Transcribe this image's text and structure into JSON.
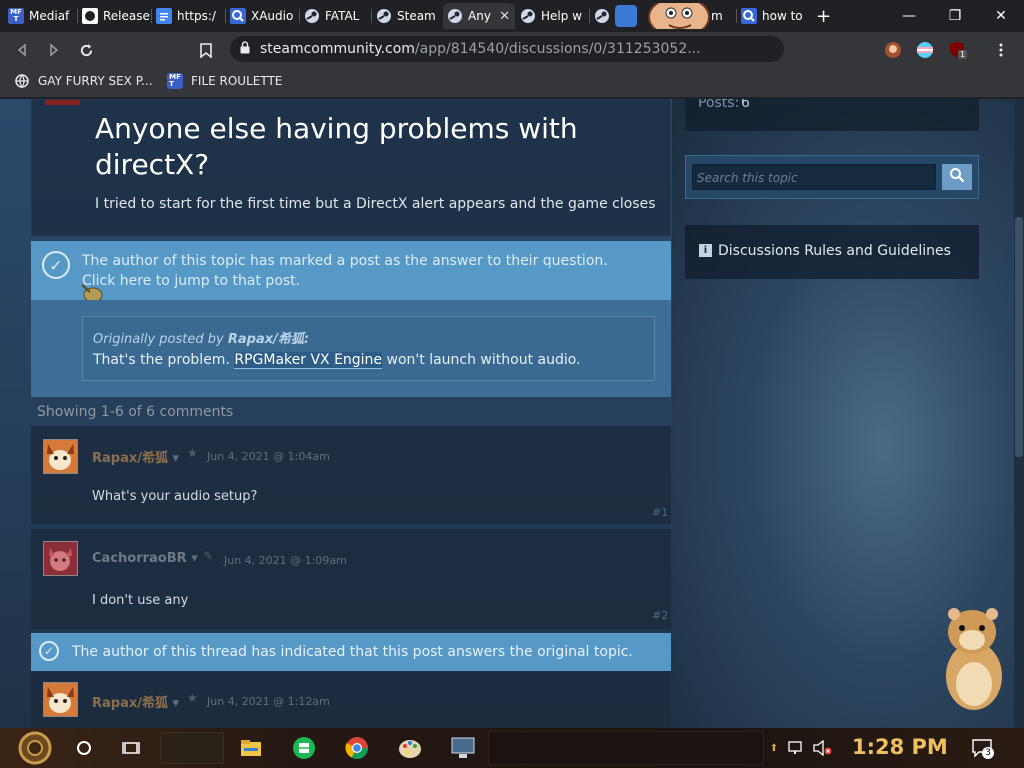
{
  "browser": {
    "tabs": [
      {
        "label": "Mediaf",
        "icon": "mf-icon"
      },
      {
        "label": "Release",
        "icon": "github-icon"
      },
      {
        "label": "https:/",
        "icon": "doc-icon"
      },
      {
        "label": "XAudio",
        "icon": "q-icon"
      },
      {
        "label": "FATAL",
        "icon": "steam-icon"
      },
      {
        "label": "Steam",
        "icon": "steam-icon"
      },
      {
        "label": "Any",
        "icon": "steam-icon"
      },
      {
        "label": "Help w",
        "icon": "steam-icon"
      },
      {
        "label": "m",
        "icon": "steam-icon"
      },
      {
        "label": "how to",
        "icon": "q-icon"
      }
    ],
    "new_tab": "+",
    "close_tab": "✕",
    "window": {
      "minimize": "—",
      "maximize": "❐",
      "close": "✕"
    },
    "url_host": "steamcommunity.com",
    "url_path": "/app/814540/discussions/0/311253052...",
    "bookmarks": [
      {
        "label": "GAY FURRY SEX P...",
        "icon": "globe-icon"
      },
      {
        "label": "FILE ROULETTE",
        "icon": "mf-icon"
      }
    ],
    "ext_badge": "1",
    "colors": {
      "frame": "#202124",
      "toolbar": "#35363a"
    }
  },
  "page": {
    "posts_label": "Posts:",
    "posts_count": "6",
    "title": "Anyone else having problems with directX?",
    "body": "I tried to start for the first time but a DirectX alert appears and the game closes",
    "answer_notice": "The author of this topic has marked a post as the answer to their question.",
    "answer_jump": "Click here to jump to that post.",
    "quote_prefix": "Originally posted by",
    "quote_author": "Rapax/希狐:",
    "quote_text_before": "That's the problem. ",
    "quote_link": "RPGMaker VX Engine",
    "quote_text_after": " won't launch without audio.",
    "showing": "Showing 1-6 of 6 comments",
    "comments": [
      {
        "author": "Rapax/希狐",
        "date": "Jun 4, 2021 @ 1:04am",
        "text": "What's your audio setup?",
        "num": "#1"
      },
      {
        "author": "CachorraoBR",
        "date": "Jun 4, 2021 @ 1:09am",
        "text": "I don't use any",
        "num": "#2"
      },
      {
        "author": "Rapax/希狐",
        "date": "Jun 4, 2021 @ 1:12am",
        "text": "",
        "num": ""
      }
    ],
    "accepted_notice": "The author of this thread has indicated that this post answers the original topic.",
    "search_placeholder": "Search this topic",
    "rules_label": "Discussions Rules and Guidelines",
    "colors": {
      "answer_blue": "#5698c6",
      "link_blue": "#8ebde3",
      "author_brown": "#8b6e4c"
    }
  },
  "taskbar": {
    "time": "1:28 PM",
    "notif_count": "3",
    "colors": {
      "clock": "#f0c060"
    }
  }
}
